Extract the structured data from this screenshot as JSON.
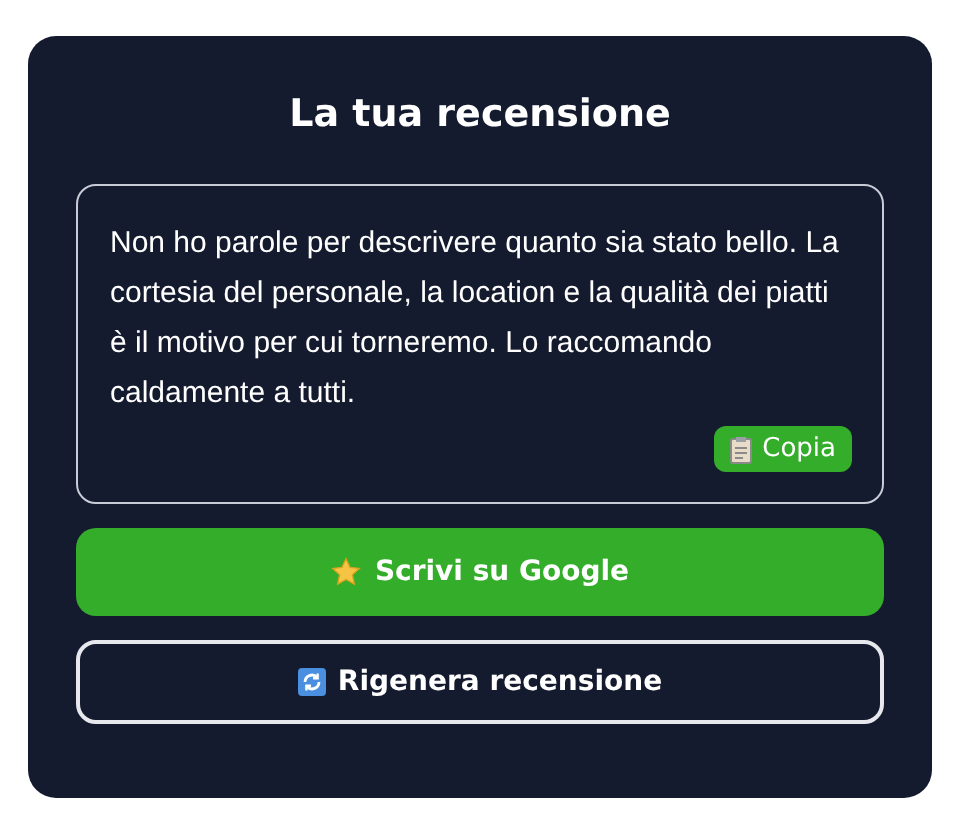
{
  "title": "La tua recensione",
  "review": {
    "text": "Non ho parole per descrivere quanto sia stato bello. La cortesia del personale, la location e la qualità dei piatti è il motivo per cui torneremo. Lo raccomando caldamente a tutti.",
    "copy_button": "Copia"
  },
  "buttons": [
    {
      "kind": "primary",
      "label": "Scrivi su Google"
    },
    {
      "kind": "secondary",
      "label": "Rigenera recensione"
    }
  ]
}
